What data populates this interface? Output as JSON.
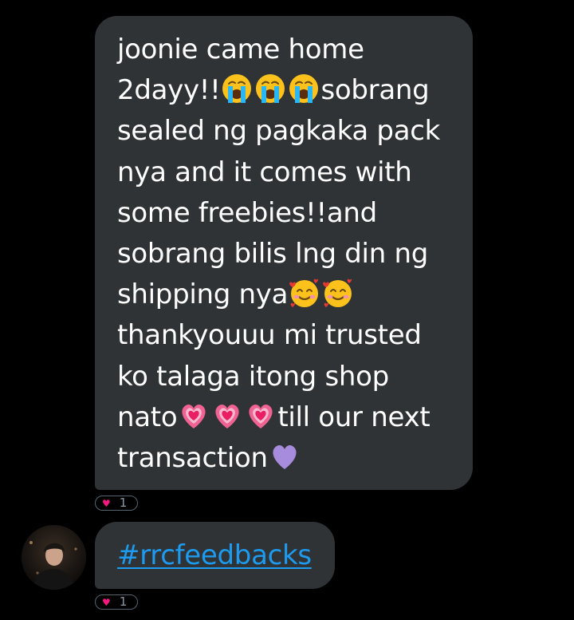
{
  "conversation": {
    "messages": [
      {
        "lines": [
          [
            "joonie came home"
          ],
          [
            "2dayy!!",
            {
              "icon": "crying-face-icon"
            },
            {
              "icon": "crying-face-icon"
            },
            {
              "icon": "crying-face-icon"
            },
            "sobrang"
          ],
          [
            "sealed ng pagkaka pack"
          ],
          [
            "nya and it comes with"
          ],
          [
            "some freebies!!and"
          ],
          [
            "sobrang bilis lng din ng"
          ],
          [
            "shipping nya",
            {
              "icon": "smiling-face-with-hearts-icon"
            },
            {
              "icon": "smiling-face-with-hearts-icon"
            }
          ],
          [
            "thankyouuu mi trusted"
          ],
          [
            "ko talaga itong shop"
          ],
          [
            "nato",
            {
              "icon": "growing-heart-icon"
            },
            {
              "icon": "growing-heart-icon"
            },
            {
              "icon": "growing-heart-icon"
            },
            "till our next"
          ],
          [
            "transaction",
            {
              "icon": "purple-heart-icon"
            }
          ]
        ],
        "reaction": {
          "icon": "heart-icon",
          "count": "1",
          "color": "#f91880"
        }
      },
      {
        "hashtag": "#rrcfeedbacks",
        "reaction": {
          "icon": "heart-icon",
          "count": "1",
          "color": "#f91880"
        },
        "avatar": "user-avatar"
      }
    ]
  },
  "colors": {
    "background": "#000000",
    "bubble": "#2f3336",
    "link": "#1d9bf0",
    "text": "#ffffff"
  }
}
